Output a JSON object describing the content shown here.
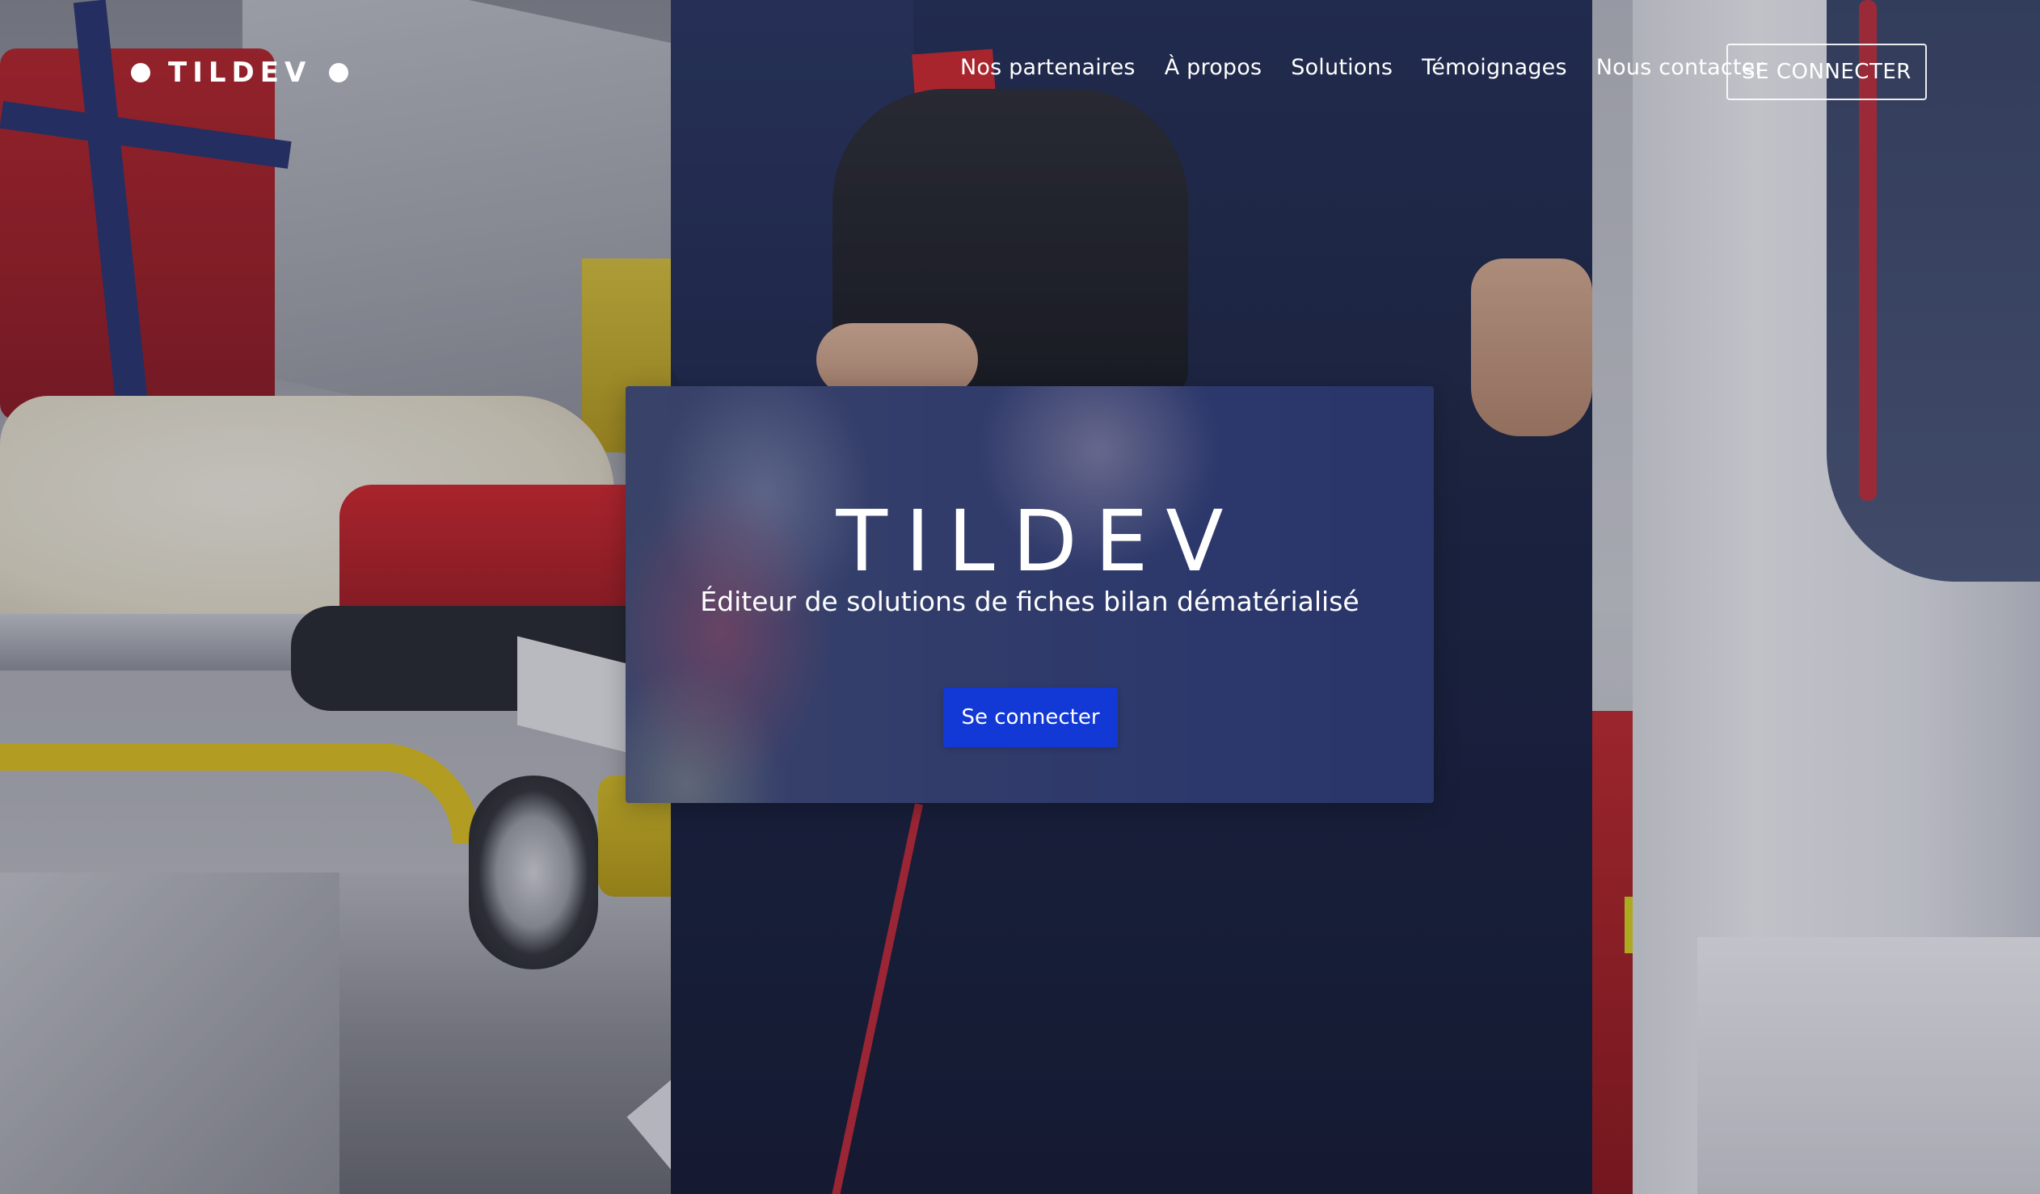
{
  "header": {
    "logo": {
      "text": "TILDEV"
    },
    "nav": [
      {
        "label": "Nos partenaires"
      },
      {
        "label": "À propos"
      },
      {
        "label": "Solutions"
      },
      {
        "label": "Témoignages"
      },
      {
        "label": "Nous contacter"
      }
    ],
    "login_button": "SE CONNECTER"
  },
  "hero": {
    "title": "TILDEV",
    "subtitle": "Éditeur de solutions de fiches bilan dématérialisé",
    "button_label": "Se connecter"
  },
  "colors": {
    "primary_button": "#1238d6",
    "text": "#ffffff"
  },
  "background": {
    "icon": "ambulance-interior-photo"
  }
}
